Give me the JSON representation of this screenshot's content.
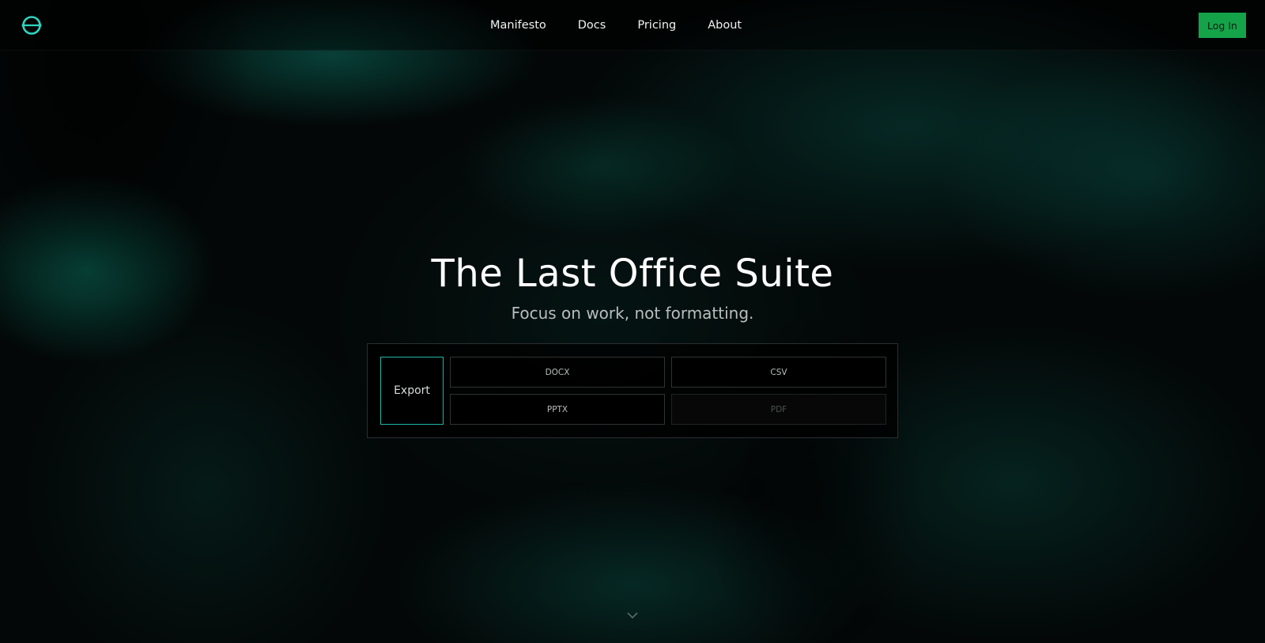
{
  "nav": {
    "items": [
      {
        "label": "Manifesto"
      },
      {
        "label": "Docs"
      },
      {
        "label": "Pricing"
      },
      {
        "label": "About"
      }
    ],
    "login_label": "Log In"
  },
  "hero": {
    "title": "The Last Office Suite",
    "subtitle": "Focus on work, not formatting."
  },
  "export_panel": {
    "export_label": "Export",
    "formats": [
      {
        "label": "DOCX",
        "enabled": true
      },
      {
        "label": "CSV",
        "enabled": true
      },
      {
        "label": "PPTX",
        "enabled": true
      },
      {
        "label": "PDF",
        "enabled": false
      }
    ]
  },
  "icons": {
    "logo": "logo-icon",
    "scroll": "chevron-down-icon"
  },
  "colors": {
    "accent": "#1fb5a5",
    "login": "#15a34a",
    "logo": "#2dd4bf"
  }
}
